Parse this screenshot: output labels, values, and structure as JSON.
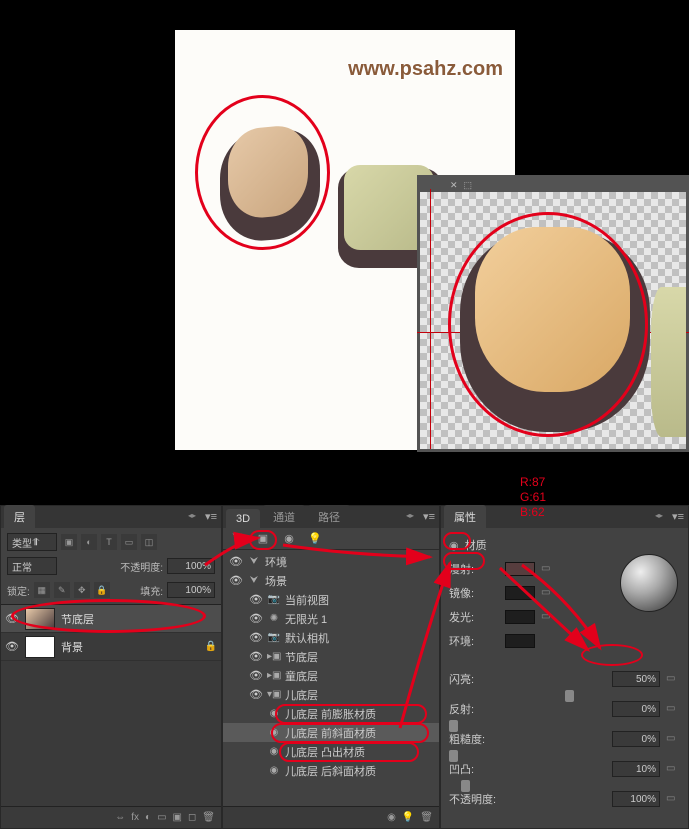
{
  "canvas": {
    "watermark": "www.psahz.com"
  },
  "layers_panel": {
    "tab": "层",
    "kind_label": "类型",
    "blend_mode": "正常",
    "opacity_label": "不透明度:",
    "opacity_value": "100%",
    "lock_label": "锁定:",
    "fill_label": "填充:",
    "fill_value": "100%",
    "layer1_name": "节底层",
    "layer2_name": "背景",
    "footer_icons": [
      "fx",
      "◐",
      "▭",
      "▣",
      "◻",
      "🗑"
    ]
  },
  "threed_panel": {
    "tabs": [
      "3D",
      "通道",
      "路径"
    ],
    "items": {
      "env": "环境",
      "scene": "场景",
      "curview": "当前视图",
      "light": "无限光 1",
      "camera": "默认相机",
      "jie": "节底层",
      "tong": "童底层",
      "er": "儿底层",
      "er_front": "儿底层 前膨胀材质",
      "er_bevel": "儿底层 前斜面材质",
      "er_extrude": "儿底层 凸出材质",
      "er_back": "儿底层 后斜面材质"
    }
  },
  "props_panel": {
    "tab": "属性",
    "header": "材质",
    "rgb": {
      "r": "R:87",
      "g": "G:61",
      "b": "B:62"
    },
    "diffuse_label": "漫射:",
    "specular_label": "镜像:",
    "glow_label": "发光:",
    "ambient_label": "环境:",
    "shine_label": "闪亮:",
    "shine_value": "50%",
    "reflect_label": "反射:",
    "reflect_value": "0%",
    "rough_label": "粗糙度:",
    "rough_value": "0%",
    "bump_label": "凹凸:",
    "bump_value": "10%",
    "opacity_label": "不透明度:",
    "opacity_value": "100%"
  }
}
